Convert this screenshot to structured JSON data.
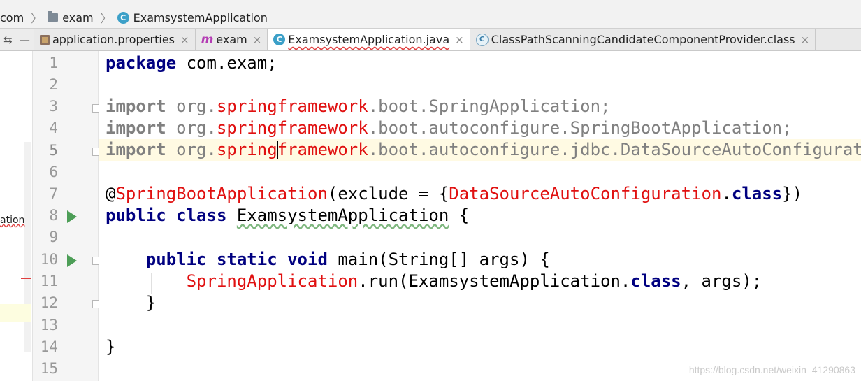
{
  "breadcrumb": [
    {
      "label": "com",
      "icon": "folder-icon"
    },
    {
      "label": "exam",
      "icon": "folder-icon"
    },
    {
      "label": "ExamsystemApplication",
      "icon": "class-icon"
    }
  ],
  "tabs": [
    {
      "label": "application.properties",
      "icon": "properties-file-icon",
      "active": false
    },
    {
      "label": "exam",
      "icon": "maven-icon",
      "active": false
    },
    {
      "label": "ExamsystemApplication.java",
      "icon": "class-icon",
      "active": true
    },
    {
      "label": "ClassPathScanningCandidateComponentProvider.class",
      "icon": "class-icon",
      "active": false
    }
  ],
  "left_panel": {
    "item_label": "ation"
  },
  "line_numbers": [
    "1",
    "2",
    "3",
    "4",
    "5",
    "6",
    "7",
    "8",
    "9",
    "10",
    "11",
    "12",
    "13",
    "14",
    "15"
  ],
  "code": {
    "l1": {
      "kw": "package",
      "rest": " com.exam;"
    },
    "l3": {
      "kw": "import",
      "a": " org.",
      "b": "springframework",
      "c": ".boot.SpringApplication;"
    },
    "l4": {
      "kw": "import",
      "a": " org.",
      "b": "springframework",
      "c": ".boot.autoconfigure.SpringBootApplication;"
    },
    "l5": {
      "kw": "import",
      "a": " org.",
      "b1": "spring",
      "b2": "framework",
      "c": ".boot.autoconfigure.jdbc.DataSourceAutoConfiguration;"
    },
    "l7": {
      "at": "@",
      "ann": "SpringBootApplication",
      "mid": "(exclude = {",
      "cls": "DataSourceAutoConfiguration",
      "dot": ".",
      "kw": "class",
      "end": "})"
    },
    "l8": {
      "kw1": "public",
      "kw2": "class",
      "name": "ExamsystemApplication",
      "end": " {"
    },
    "l10": {
      "kw1": "public",
      "kw2": "static",
      "kw3": "void",
      "rest": " main(String[] args) {"
    },
    "l11": {
      "red": "SpringApplication",
      "mid": ".run(ExamsystemApplication.",
      "kw": "class",
      "end": ", args);"
    },
    "l12": {
      "text": "}"
    },
    "l14": {
      "text": "}"
    }
  },
  "watermark": "https://blog.csdn.net/weixin_41290863",
  "colors": {
    "keyword": "#000080",
    "error_red": "#e01010",
    "import_gray": "#808080",
    "run_green": "#4d9e57"
  }
}
